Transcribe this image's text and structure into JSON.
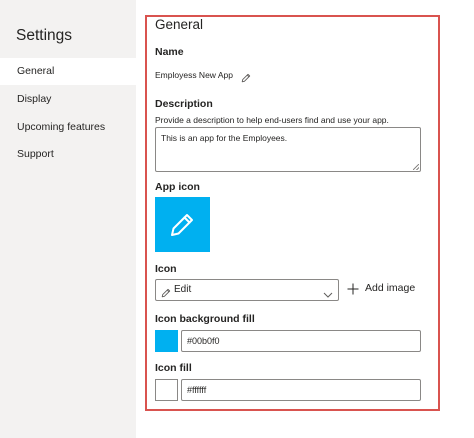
{
  "colors": {
    "accent_fill": "#00b0f0",
    "icon_fill": "#ffffff",
    "highlight_border": "#d9534f"
  },
  "sidebar": {
    "title": "Settings",
    "items": [
      {
        "label": "General",
        "active": true
      },
      {
        "label": "Display",
        "active": false
      },
      {
        "label": "Upcoming features",
        "active": false
      },
      {
        "label": "Support",
        "active": false
      }
    ]
  },
  "general": {
    "title": "General",
    "name_label": "Name",
    "name_value": "Employess New App",
    "name_edit_icon": "pencil-icon",
    "description_label": "Description",
    "description_help": "Provide a description to help end-users find and use your app.",
    "description_value": "This is an app for the Employees.",
    "app_icon_label": "App icon",
    "app_icon_glyph": "pencil-icon",
    "icon_label": "Icon",
    "icon_select_value": "Edit",
    "icon_select_icon": "pencil-icon",
    "add_image_label": "Add image",
    "icon_bg_label": "Icon background fill",
    "icon_bg_value": "#00b0f0",
    "icon_fill_label": "Icon fill",
    "icon_fill_value": "#ffffff"
  }
}
